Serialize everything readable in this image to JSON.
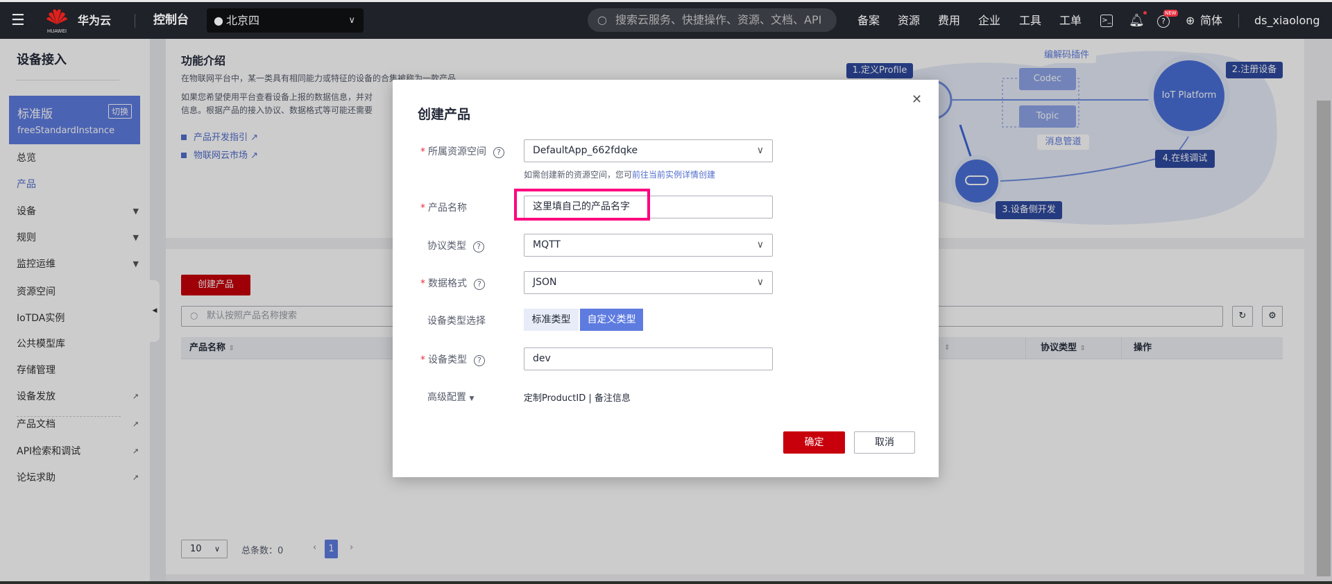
{
  "header": {
    "logo_text": "HUAWEI",
    "brand": "华为云",
    "console": "控制台",
    "region": "北京四",
    "search_placeholder": "搜索云服务、快捷操作、资源、文档、API",
    "nav": [
      "备案",
      "资源",
      "费用",
      "企业",
      "工具",
      "工单"
    ],
    "new_badge": "NEW",
    "language": "简体",
    "user": "ds_xiaolong"
  },
  "sidebar": {
    "title": "设备接入",
    "edition": "标准版",
    "switch": "切换",
    "instance": "freeStandardInstance",
    "items": [
      {
        "label": "总览"
      },
      {
        "label": "产品",
        "active": true
      },
      {
        "label": "设备",
        "expand": true
      },
      {
        "label": "规则",
        "expand": true
      },
      {
        "label": "监控运维",
        "expand": true
      },
      {
        "label": "资源空间"
      },
      {
        "label": "IoTDA实例"
      },
      {
        "label": "公共模型库"
      },
      {
        "label": "存储管理"
      },
      {
        "label": "设备发放",
        "external": true
      },
      {
        "label": "产品文档",
        "external": true
      },
      {
        "label": "API检索和调试",
        "external": true
      },
      {
        "label": "论坛求助",
        "external": true
      }
    ]
  },
  "intro": {
    "title": "功能介绍",
    "line1": "在物联网平台中，某一类具有相同能力或特征的设备的合集被称为一款产品",
    "line2": "如果您希望使用平台查看设备上报的数据信息，并对",
    "line3": "信息。根据产品的接入协议、数据格式等可能还需要",
    "link1": "产品开发指引",
    "link2": "物联网云市场"
  },
  "diagram": {
    "step1": "1.定义Profile",
    "step2": "2.注册设备",
    "step3": "3.设备侧开发",
    "step4": "4.在线调试",
    "codec": "Codec",
    "topic": "Topic",
    "codec_label": "编解码插件",
    "topic_label": "消息管道",
    "platform": "IoT Platform"
  },
  "list": {
    "create_button": "创建产品",
    "search_placeholder": "默认按照产品名称搜索",
    "columns": [
      "产品名称",
      "协议类型",
      "操作"
    ],
    "page_size": "10",
    "total_label": "总条数：0",
    "current_page": "1"
  },
  "modal": {
    "title": "创建产品",
    "resource_space": {
      "label": "所属资源空间",
      "value": "DefaultApp_662fdqke",
      "hint": "如需创建新的资源空间，您可",
      "hint_link": "前往当前实例详情创建"
    },
    "product_name": {
      "label": "产品名称",
      "value": "这里填自己的产品名字"
    },
    "protocol": {
      "label": "协议类型",
      "value": "MQTT"
    },
    "data_format": {
      "label": "数据格式",
      "value": "JSON"
    },
    "device_type_select": {
      "label": "设备类型选择",
      "options": [
        "标准类型",
        "自定义类型"
      ],
      "selected": "自定义类型"
    },
    "device_type": {
      "label": "设备类型",
      "value": "dev"
    },
    "advanced": {
      "label": "高级配置",
      "value": "定制ProductID | 备注信息"
    },
    "confirm": "确定",
    "cancel": "取消"
  },
  "colors": {
    "brand_red": "#c7000b",
    "accent_blue": "#5e7ce0",
    "highlight": "#ff007f"
  }
}
